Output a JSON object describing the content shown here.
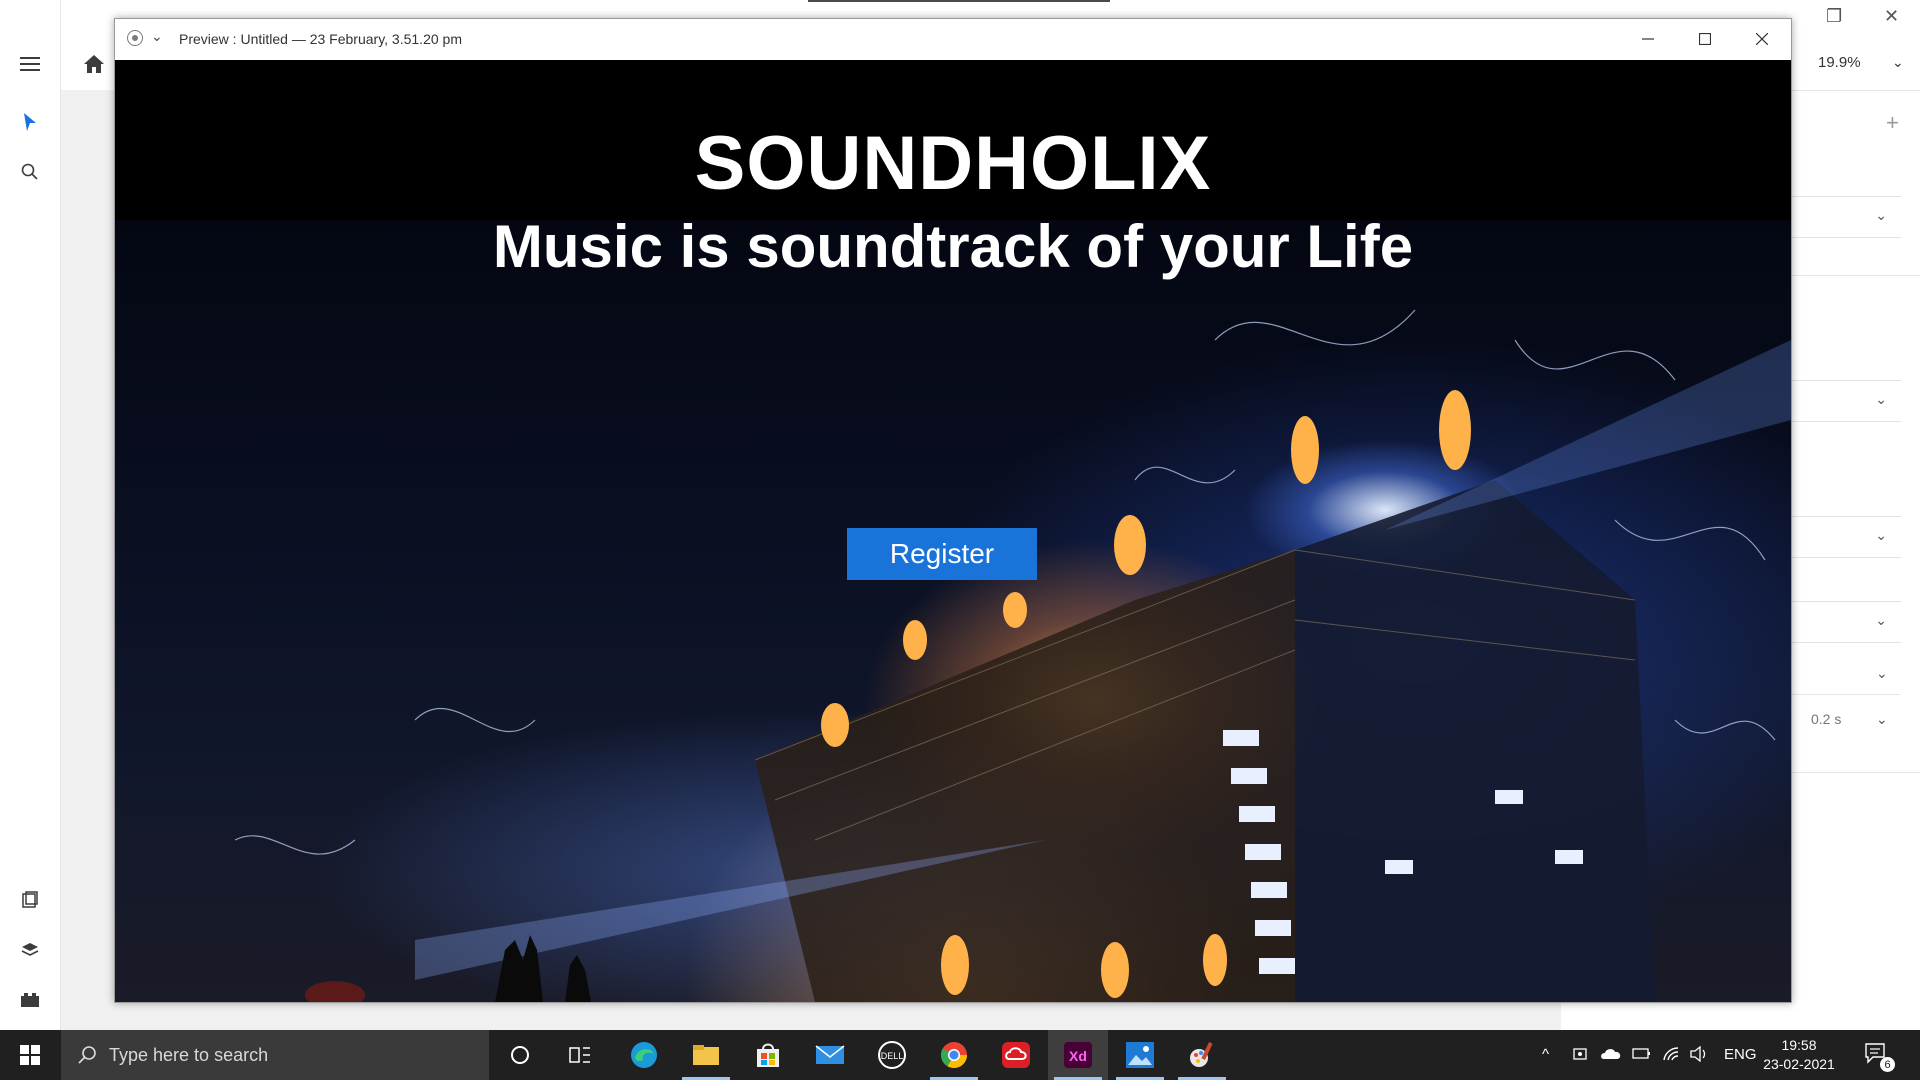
{
  "preview": {
    "title": "Preview : Untitled — 23 February, 3.51.20 pm"
  },
  "site": {
    "brand": "SOUNDHOLIX",
    "tagline": "Music is soundtrack of your Life",
    "register_label": "Register"
  },
  "xd": {
    "zoom": "19.9%",
    "duration": "0.2 s"
  },
  "taskbar": {
    "search_placeholder": "Type here to search",
    "language": "ENG",
    "time": "19:58",
    "date": "23-02-2021",
    "notification_count": "6",
    "apps": [
      "cortana-icon",
      "task-view-icon",
      "edge-icon",
      "file-explorer-icon",
      "store-icon",
      "mail-icon",
      "dell-icon",
      "chrome-icon",
      "creative-cloud-icon",
      "xd-icon",
      "photos-icon",
      "paint-icon"
    ]
  },
  "colors": {
    "register_button": "#1a73d9",
    "header_background": "#000000",
    "taskbar": "#202020"
  }
}
